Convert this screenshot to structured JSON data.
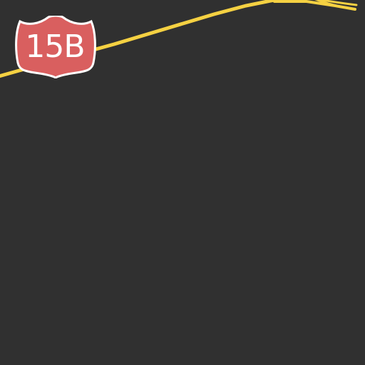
{
  "map": {
    "background_color": "#303030",
    "road_color": "#f5d142",
    "shield": {
      "icon": "us-highway-shield-icon",
      "label": "15B",
      "fill_color": "#d95f5f",
      "border_color": "#ffffff"
    }
  }
}
